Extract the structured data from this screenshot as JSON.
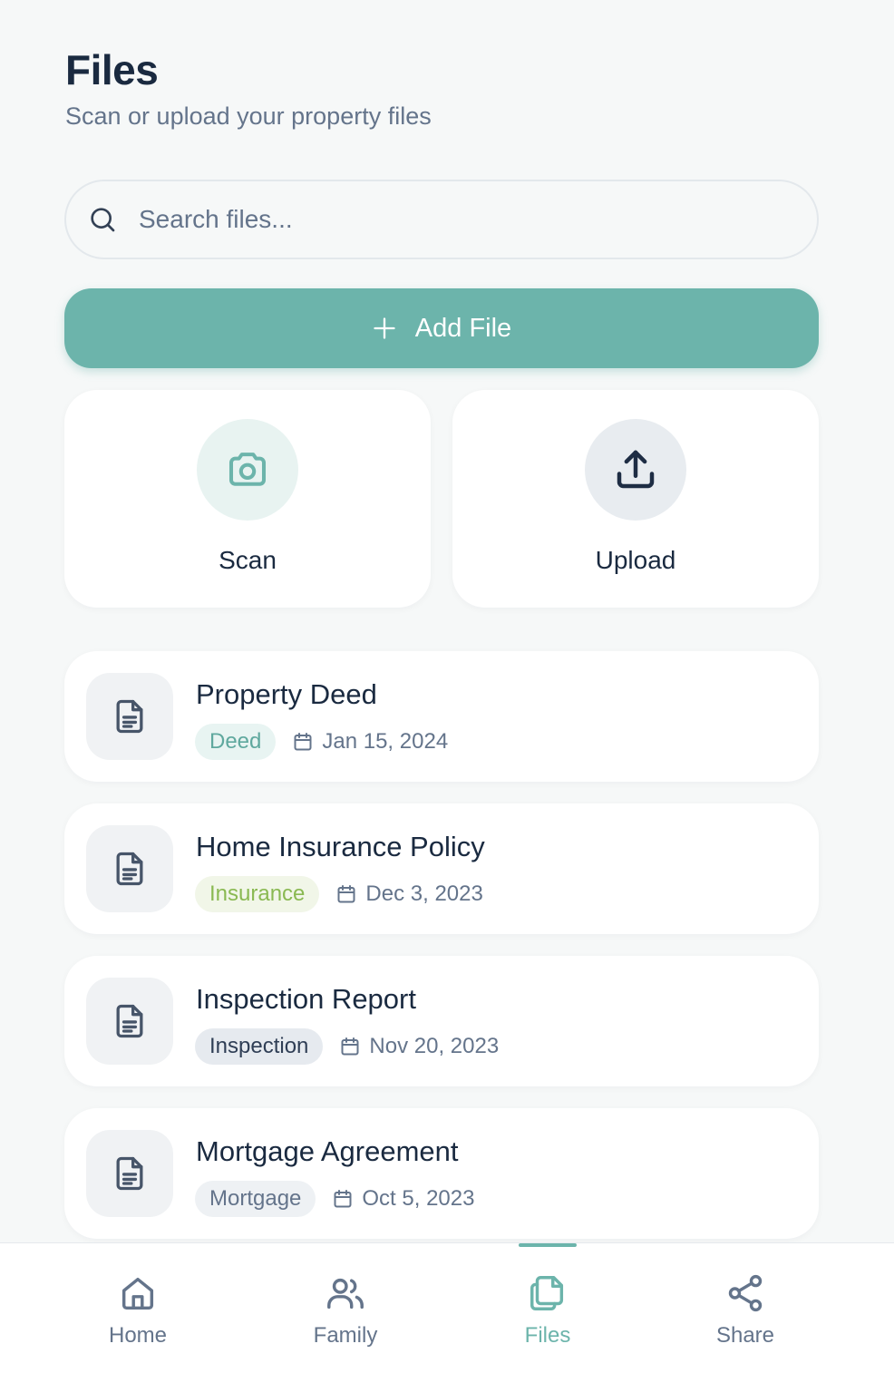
{
  "header": {
    "title": "Files",
    "subtitle": "Scan or upload your property files"
  },
  "search": {
    "placeholder": "Search files...",
    "icon": "search-icon"
  },
  "add_button": {
    "label": "Add File",
    "icon": "plus-icon"
  },
  "actions": [
    {
      "label": "Scan",
      "icon": "camera-icon"
    },
    {
      "label": "Upload",
      "icon": "upload-icon"
    }
  ],
  "files": [
    {
      "name": "Property Deed",
      "tag": "Deed",
      "date": "Jan 15, 2024",
      "tag_color": "#5fa89e",
      "tag_bg": "#e8f4f2"
    },
    {
      "name": "Home Insurance Policy",
      "tag": "Insurance",
      "date": "Dec 3, 2023",
      "tag_color": "#8ab952",
      "tag_bg": "#f1f6e8"
    },
    {
      "name": "Inspection Report",
      "tag": "Inspection",
      "date": "Nov 20, 2023",
      "tag_color": "#2f3e55",
      "tag_bg": "#e6eaef"
    },
    {
      "name": "Mortgage Agreement",
      "tag": "Mortgage",
      "date": "Oct 5, 2023",
      "tag_color": "#64748b",
      "tag_bg": "#eef1f4"
    }
  ],
  "tabs": [
    {
      "label": "Home",
      "icon": "home-icon",
      "active": false
    },
    {
      "label": "Family",
      "icon": "users-icon",
      "active": false
    },
    {
      "label": "Files",
      "icon": "files-icon",
      "active": true
    },
    {
      "label": "Share",
      "icon": "share-icon",
      "active": false
    }
  ],
  "colors": {
    "accent": "#6cb4ab",
    "text_primary": "#1a2a40",
    "text_secondary": "#64748b",
    "background": "#f6f8f8"
  }
}
